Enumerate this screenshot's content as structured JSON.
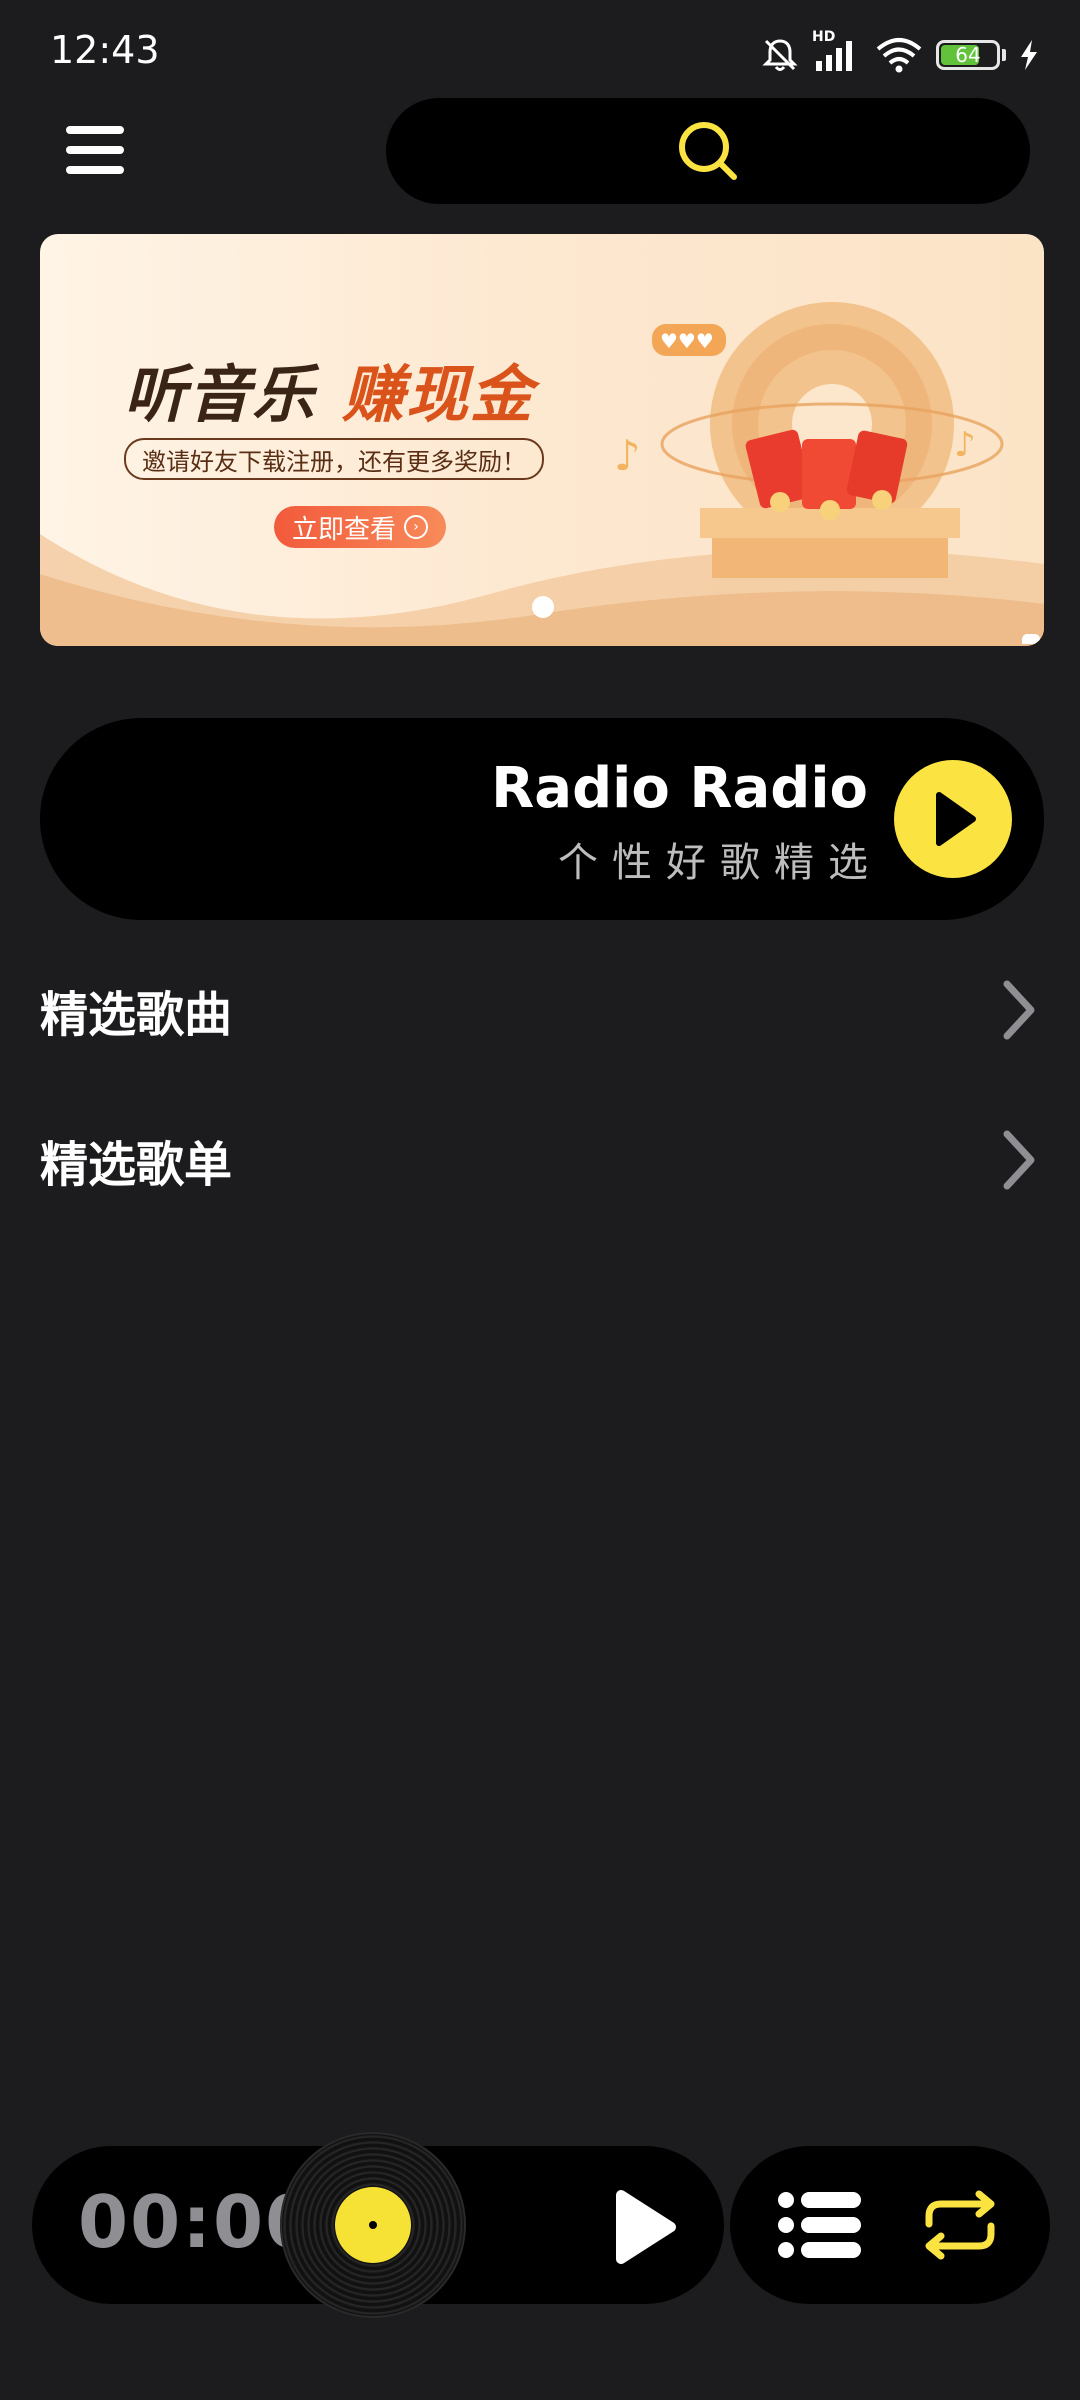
{
  "status_bar": {
    "time": "12:43",
    "network_label": "HD",
    "battery_level": "64",
    "icons": [
      "bell-muted-icon",
      "signal-icon",
      "wifi-icon",
      "battery-icon",
      "charging-icon"
    ]
  },
  "header": {
    "menu_icon": "hamburger-menu-icon",
    "search_icon": "search-icon"
  },
  "banner": {
    "title_part1": "听音乐",
    "title_part2": "赚现金",
    "subtitle": "邀请好友下载注册，还有更多奖励！",
    "cta_label": "立即查看",
    "cta_icon": "chevron-right-circle-icon",
    "active_slide": 1
  },
  "radio": {
    "title": "Radio Radio",
    "subtitle": "个性好歌精选",
    "play_icon": "play-icon"
  },
  "sections": [
    {
      "title": "精选歌曲",
      "icon": "chevron-right-icon"
    },
    {
      "title": "精选歌单",
      "icon": "chevron-right-icon"
    }
  ],
  "player": {
    "time": "00:00",
    "disc_icon": "vinyl-disc-icon",
    "play_icon": "play-icon",
    "playlist_icon": "playlist-icon",
    "repeat_icon": "repeat-icon"
  },
  "colors": {
    "background": "#1c1c1e",
    "accent": "#fbe342",
    "card": "#000000",
    "muted_text": "#8e8e93"
  }
}
